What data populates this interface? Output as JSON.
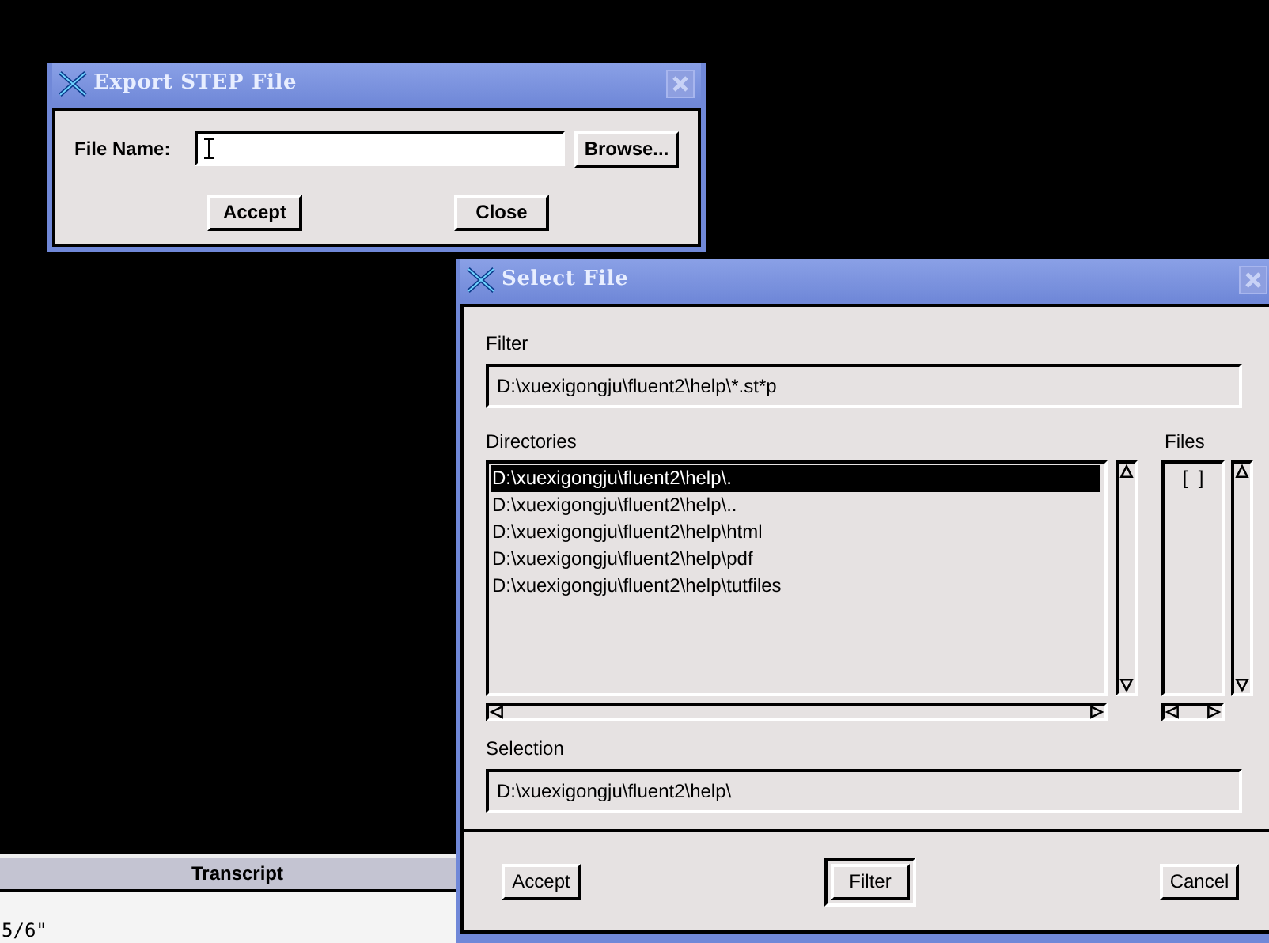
{
  "transcript": {
    "title": "Transcript",
    "lines": [
      "5/6\""
    ]
  },
  "export_dialog": {
    "title": "Export STEP File",
    "file_name_label": "File Name:",
    "buttons": [
      "Browse...",
      "Accept",
      "Close"
    ]
  },
  "select_dialog": {
    "title": "Select File",
    "filter_label": "Filter",
    "filter_value": "D:\\xuexigongju\\fluent2\\help\\*.st*p",
    "directories_label": "Directories",
    "directories": [
      {
        "path": "D:\\xuexigongju\\fluent2\\help\\.",
        "selected": true
      },
      {
        "path": "D:\\xuexigongju\\fluent2\\help\\..",
        "selected": false
      },
      {
        "path": "D:\\xuexigongju\\fluent2\\help\\html",
        "selected": false
      },
      {
        "path": "D:\\xuexigongju\\fluent2\\help\\pdf",
        "selected": false
      },
      {
        "path": "D:\\xuexigongju\\fluent2\\help\\tutfiles",
        "selected": false
      }
    ],
    "files_label": "Files",
    "files": [
      "[  ]"
    ],
    "selection_label": "Selection",
    "selection_value": "D:\\xuexigongju\\fluent2\\help\\",
    "buttons": [
      {
        "label": "Accept",
        "default": false
      },
      {
        "label": "Filter",
        "default": true
      },
      {
        "label": "Cancel",
        "default": false
      }
    ]
  }
}
